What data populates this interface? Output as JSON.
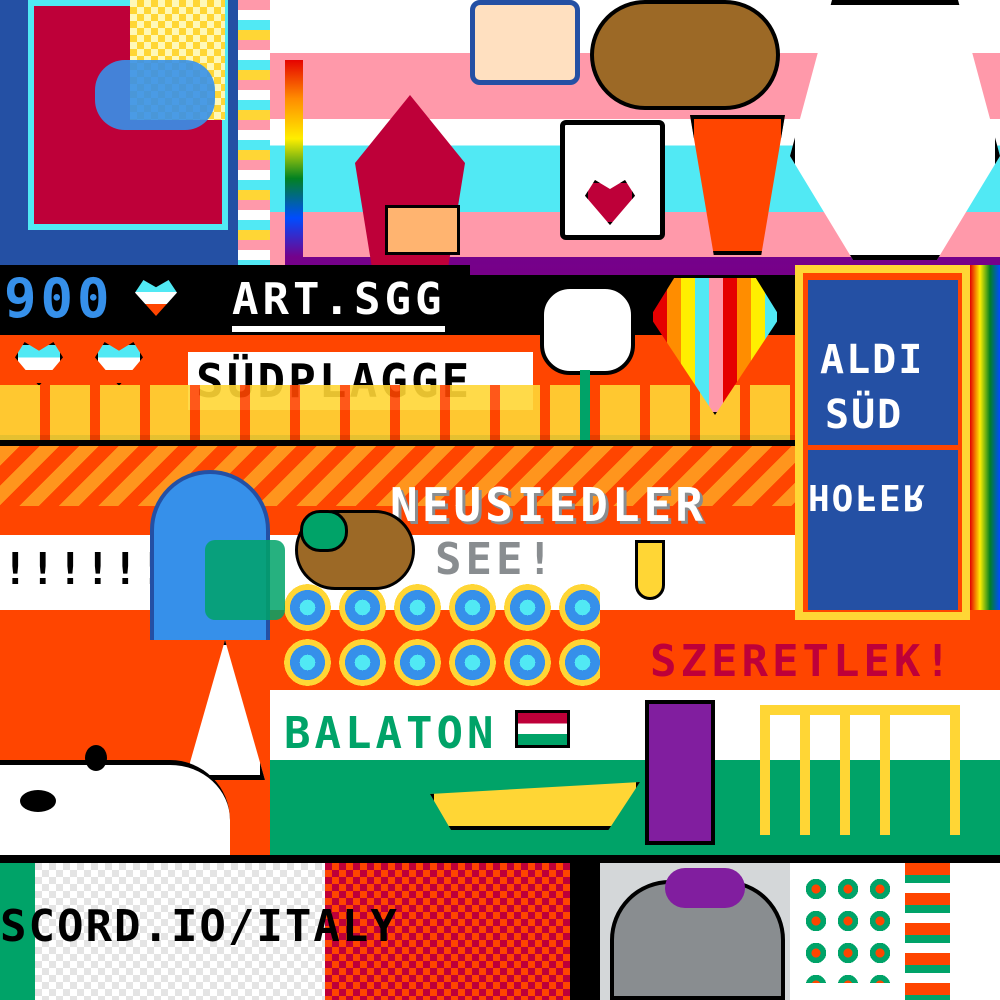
{
  "labels": {
    "counter": "900",
    "art": "ART.SGG",
    "sudplagge": "SÜDPLAGGE",
    "neusiedler": "NEUSIEDLER",
    "see": "SEE!",
    "exclaim": "!!!!!!!!",
    "aldi1": "ALDI",
    "aldi2": "SÜD",
    "hofer": "HOFER",
    "szeretlek": "SZERETLEK!",
    "balaton": "BALATON",
    "italy": "SCORD.IO/ITALY"
  },
  "colors": {
    "austria_red": "#ff4500",
    "white": "#ffffff",
    "black": "#000000",
    "yellow": "#ffd635",
    "pink": "#ff99aa",
    "cyan": "#51e9f4",
    "dark_blue": "#2450a4",
    "green": "#00a368",
    "dark_red": "#be0039",
    "brown": "#9c6926",
    "purple": "#811e9f",
    "gray": "#898d90"
  }
}
